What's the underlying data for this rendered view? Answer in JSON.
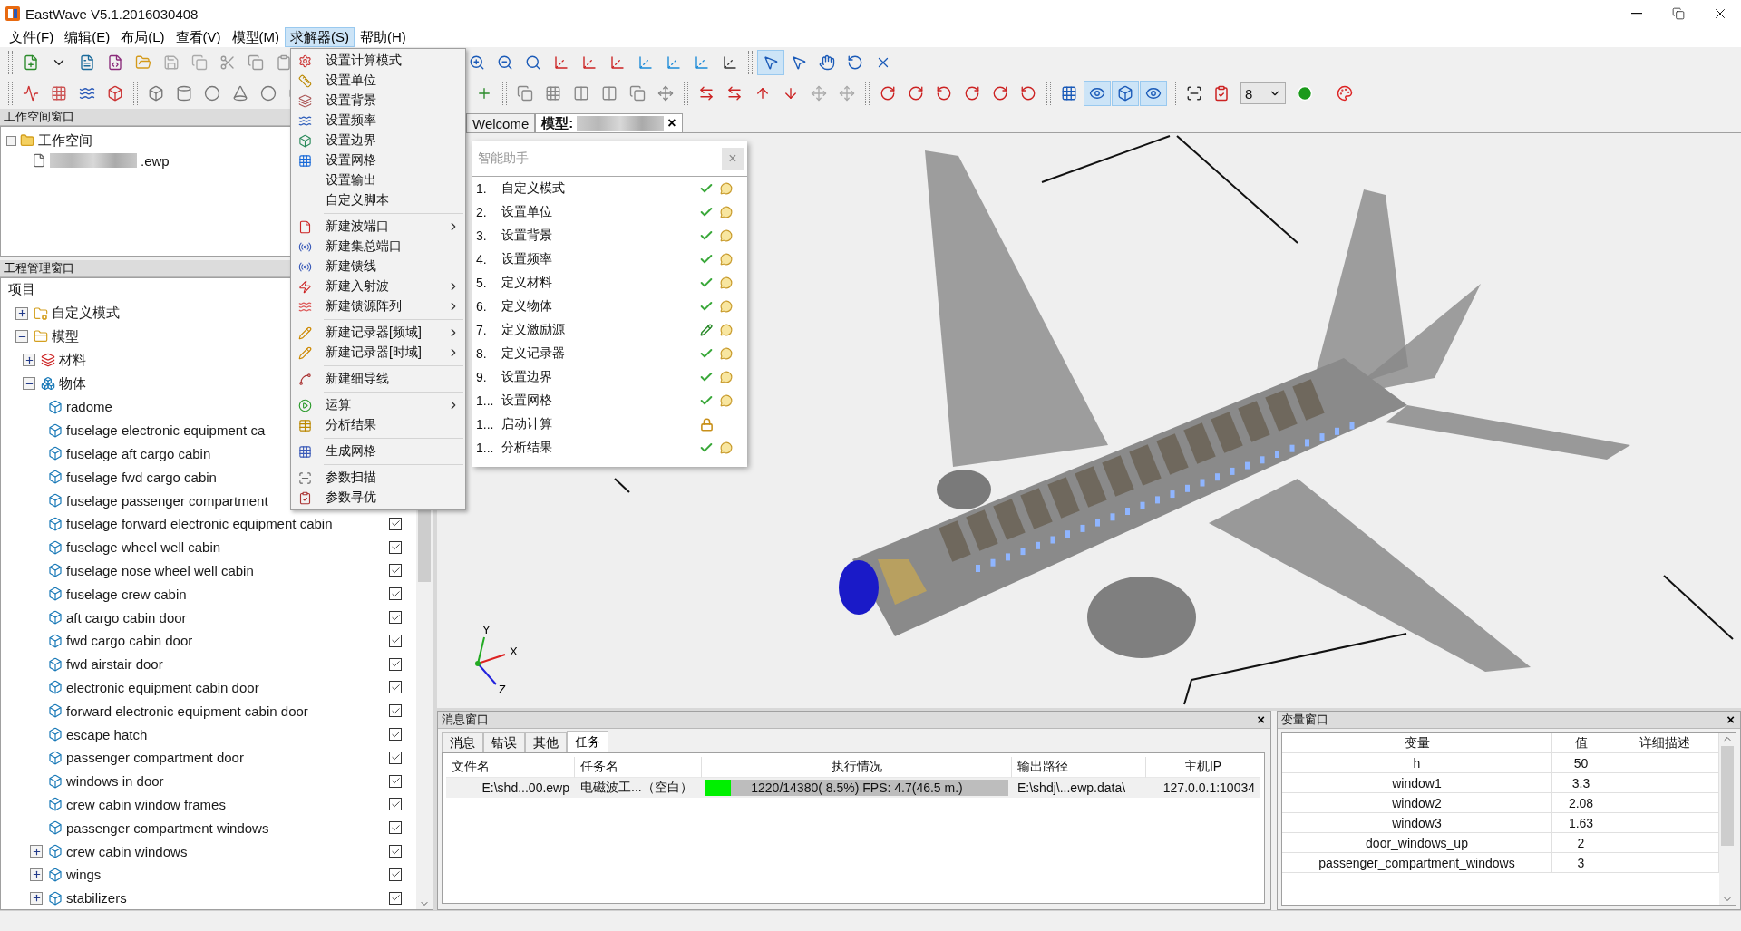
{
  "window": {
    "title": "EastWave V5.1.2016030408"
  },
  "menu_bar": [
    {
      "label": "文件(F)",
      "selected": false
    },
    {
      "label": "编辑(E)",
      "selected": false
    },
    {
      "label": "布局(L)",
      "selected": false
    },
    {
      "label": "查看(V)",
      "selected": false
    },
    {
      "label": "模型(M)",
      "selected": false
    },
    {
      "label": "求解器(S)",
      "selected": true
    },
    {
      "label": "帮助(H)",
      "selected": false
    }
  ],
  "toolbars": {
    "rows": [
      [
        [
          {
            "on": false
          },
          {
            "on": false
          },
          {
            "on": false
          },
          {
            "on": false
          },
          {
            "on": false
          },
          {
            "on": false
          },
          {
            "on": false
          },
          {
            "on": false
          },
          {
            "on": false
          },
          {
            "on": false
          }
        ],
        [
          {
            "on": false
          },
          {
            "on": false
          },
          {
            "on": false
          },
          {
            "on": false
          },
          {
            "on": false
          },
          {
            "on": false
          },
          {
            "on": false
          },
          {
            "on": false
          },
          {
            "on": false
          },
          {
            "on": false
          }
        ],
        [
          {
            "on": true
          },
          {
            "on": false
          },
          {
            "on": false
          },
          {
            "on": false
          },
          {
            "on": false
          }
        ]
      ],
      [
        [
          {
            "on": false
          },
          {
            "on": false
          },
          {
            "on": false
          },
          {
            "on": false
          }
        ],
        [
          {
            "on": false
          },
          {
            "on": false
          },
          {
            "on": false
          },
          {
            "on": false
          },
          {
            "on": false
          },
          {
            "on": false
          }
        ],
        [
          {
            "on": false
          }
        ],
        [
          {
            "on": false
          },
          {
            "on": false
          },
          {
            "on": false
          },
          {
            "on": false
          },
          {
            "on": false
          },
          {
            "on": false
          }
        ],
        [
          {
            "on": false
          },
          {
            "on": false
          },
          {
            "on": false
          },
          {
            "on": false
          },
          {
            "on": false
          },
          {
            "on": false
          }
        ],
        [
          {
            "on": false
          },
          {
            "on": false
          },
          {
            "on": false
          },
          {
            "on": false
          },
          {
            "on": false
          },
          {
            "on": false
          }
        ],
        [
          {
            "on": false
          },
          {
            "on": true
          },
          {
            "on": true
          },
          {
            "on": true
          }
        ]
      ]
    ],
    "grid_select": {
      "value": "8"
    }
  },
  "solver_menu": [
    [
      {
        "label": "设置计算模式",
        "submenu": false
      },
      {
        "label": "设置单位",
        "submenu": false
      },
      {
        "label": "设置背景",
        "submenu": false
      },
      {
        "label": "设置频率",
        "submenu": false
      },
      {
        "label": "设置边界",
        "submenu": false
      },
      {
        "label": "设置网格",
        "submenu": false
      },
      {
        "label": "设置输出",
        "submenu": false
      },
      {
        "label": "自定义脚本",
        "submenu": false
      }
    ],
    [
      {
        "label": "新建波端口",
        "submenu": true
      },
      {
        "label": "新建集总端口",
        "submenu": false
      },
      {
        "label": "新建馈线",
        "submenu": false
      },
      {
        "label": "新建入射波",
        "submenu": true
      },
      {
        "label": "新建馈源阵列",
        "submenu": true
      }
    ],
    [
      {
        "label": "新建记录器[频域]",
        "submenu": true
      },
      {
        "label": "新建记录器[时域]",
        "submenu": true
      }
    ],
    [
      {
        "label": "新建细导线",
        "submenu": false
      }
    ],
    [
      {
        "label": "运算",
        "submenu": true
      },
      {
        "label": "分析结果",
        "submenu": false
      }
    ],
    [
      {
        "label": "生成网格",
        "submenu": false
      }
    ],
    [
      {
        "label": "参数扫描",
        "submenu": false
      },
      {
        "label": "参数寻优",
        "submenu": false
      }
    ]
  ],
  "workspace": {
    "header": "工作空间窗口",
    "root": {
      "label": "工作空间",
      "expanded": true
    },
    "files": [
      {
        "suffix": ".ewp"
      }
    ]
  },
  "project": {
    "header": "工程管理窗口",
    "root": "项目",
    "children": [
      {
        "label": "自定义模式",
        "kind": "modes",
        "expanded": false
      },
      {
        "label": "模型",
        "kind": "models",
        "expanded": true,
        "children": [
          {
            "label": "材料",
            "kind": "materials",
            "expanded": false
          },
          {
            "label": "物体",
            "kind": "bodies",
            "expanded": true,
            "children": [
              {
                "label": "radome",
                "kind": "body"
              },
              {
                "label": "fuselage electronic equipment ca",
                "kind": "body"
              },
              {
                "label": "fuselage aft cargo cabin",
                "kind": "body"
              },
              {
                "label": "fuselage fwd cargo cabin",
                "kind": "body"
              },
              {
                "label": "fuselage passenger compartment",
                "kind": "body"
              },
              {
                "label": "fuselage forward electronic equipment cabin",
                "kind": "body",
                "checked": true
              },
              {
                "label": "fuselage wheel well cabin",
                "kind": "body",
                "checked": true
              },
              {
                "label": "fuselage nose wheel well cabin",
                "kind": "body",
                "checked": true
              },
              {
                "label": "fuselage crew cabin",
                "kind": "body",
                "checked": true
              },
              {
                "label": "aft cargo cabin door",
                "kind": "body",
                "checked": true
              },
              {
                "label": "fwd cargo cabin door",
                "kind": "body",
                "checked": true
              },
              {
                "label": "fwd airstair door",
                "kind": "body",
                "checked": true
              },
              {
                "label": "electronic equipment cabin door",
                "kind": "body",
                "checked": true
              },
              {
                "label": "forward electronic equipment cabin door",
                "kind": "body",
                "checked": true
              },
              {
                "label": "escape hatch",
                "kind": "body",
                "checked": true
              },
              {
                "label": "passenger compartment door",
                "kind": "body",
                "checked": true
              },
              {
                "label": "windows in door",
                "kind": "body",
                "checked": true
              },
              {
                "label": "crew cabin window frames",
                "kind": "body",
                "checked": true
              },
              {
                "label": "passenger compartment windows",
                "kind": "body",
                "checked": true
              },
              {
                "label": "crew cabin windows",
                "kind": "body",
                "expanded": false,
                "checked": true
              },
              {
                "label": "wings",
                "kind": "body",
                "expanded": false,
                "checked": true
              },
              {
                "label": "stabilizers",
                "kind": "body",
                "expanded": false,
                "checked": true
              }
            ]
          }
        ]
      }
    ]
  },
  "document_tabs": [
    {
      "label": "Welcome",
      "selected": false
    },
    {
      "label": "模型:",
      "selected": true,
      "close": "×"
    }
  ],
  "viewport": {
    "axes": [
      "X",
      "Y",
      "Z"
    ]
  },
  "assistant": {
    "title": "智能助手",
    "close": "×",
    "steps": [
      {
        "number": "1.",
        "label": "自定义模式",
        "kind": "done"
      },
      {
        "number": "2.",
        "label": "设置单位",
        "kind": "done"
      },
      {
        "number": "3.",
        "label": "设置背景",
        "kind": "done"
      },
      {
        "number": "4.",
        "label": "设置频率",
        "kind": "done"
      },
      {
        "number": "5.",
        "label": "定义材料",
        "kind": "done"
      },
      {
        "number": "6.",
        "label": "定义物体",
        "kind": "done"
      },
      {
        "number": "7.",
        "label": "定义激励源",
        "kind": "editing"
      },
      {
        "number": "8.",
        "label": "定义记录器",
        "kind": "done"
      },
      {
        "number": "9.",
        "label": "设置边界",
        "kind": "done"
      },
      {
        "number": "1...",
        "label": "设置网格",
        "kind": "done"
      },
      {
        "number": "1...",
        "label": "启动计算",
        "kind": "locked"
      },
      {
        "number": "1...",
        "label": "分析结果",
        "kind": "done"
      }
    ]
  },
  "messages": {
    "header": "消息窗口",
    "close": "×",
    "tabs": [
      {
        "label": "消息",
        "selected": false
      },
      {
        "label": "错误",
        "selected": false
      },
      {
        "label": "其他",
        "selected": false
      },
      {
        "label": "任务",
        "selected": true
      }
    ],
    "columns": [
      "文件名",
      "任务名",
      "执行情况",
      "输出路径",
      "主机IP"
    ],
    "rows": [
      {
        "file": "E:\\shd...00.ewp",
        "task": "电磁波工...（空白）",
        "progress": {
          "level": 0.085,
          "text": "1220/14380( 8.5%) FPS:  4.7(46.5 m.)"
        },
        "output": "E:\\shdj\\...ewp.data\\",
        "host": "127.0.0.1:10034"
      }
    ]
  },
  "variables": {
    "header": "变量窗口",
    "close": "×",
    "columns": [
      "变量",
      "值",
      "详细描述"
    ],
    "rows": [
      {
        "name": "h",
        "value": "50"
      },
      {
        "name": "window1",
        "value": "3.3"
      },
      {
        "name": "window2",
        "value": "2.08"
      },
      {
        "name": "window3",
        "value": "1.63"
      },
      {
        "name": "door_windows_up",
        "value": "2"
      },
      {
        "name": "passenger_compartment_windows",
        "value": "3"
      }
    ]
  }
}
